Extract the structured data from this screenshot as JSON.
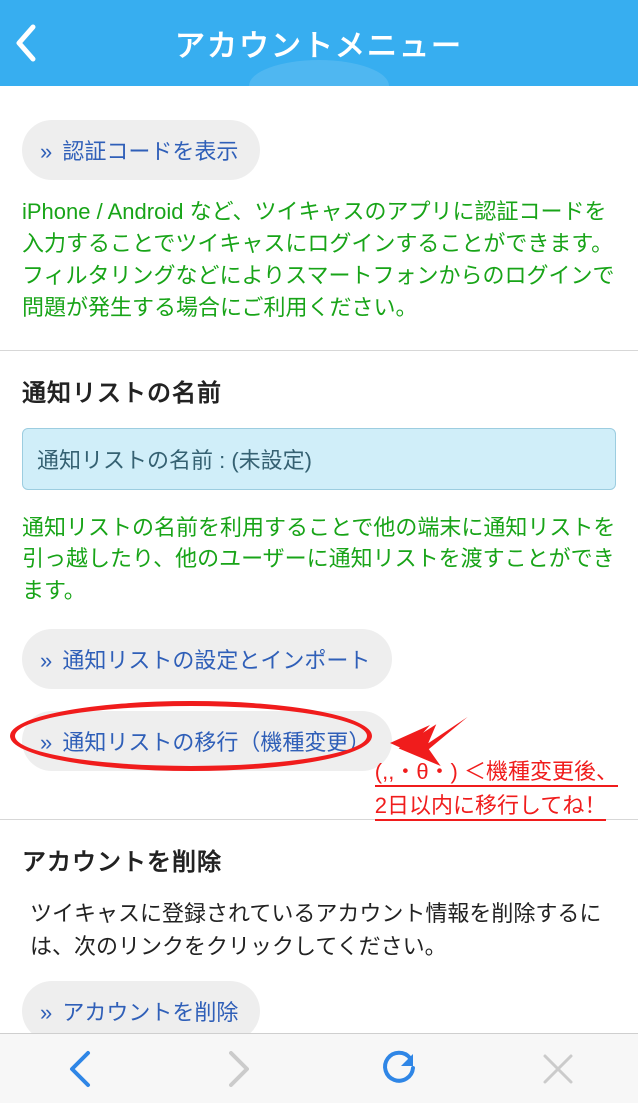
{
  "header": {
    "title": "アカウントメニュー"
  },
  "authcode": {
    "button_label": "認証コードを表示",
    "description": "iPhone / Android など、ツイキャスのアプリに認証コードを入力することでツイキャスにログインすることができます。フィルタリングなどによりスマートフォンからのログインで問題が発生する場合にご利用ください。"
  },
  "notif": {
    "heading": "通知リストの名前",
    "box_text": "通知リストの名前 : (未設定)",
    "description": "通知リストの名前を利用することで他の端末に通知リストを引っ越したり、他のユーザーに通知リストを渡すことができます。",
    "settings_button": "通知リストの設定とインポート",
    "migrate_button": "通知リストの移行（機種変更）"
  },
  "delete": {
    "heading": "アカウントを削除",
    "description": "ツイキャスに登録されているアカウント情報を削除するには、次のリンクをクリックしてください。",
    "button_label": "アカウントを削除"
  },
  "speech": {
    "line1": "(,,・θ・) ＜機種変更後、",
    "line2": "2日以内に移行してね！"
  },
  "pill_prefix": "»"
}
